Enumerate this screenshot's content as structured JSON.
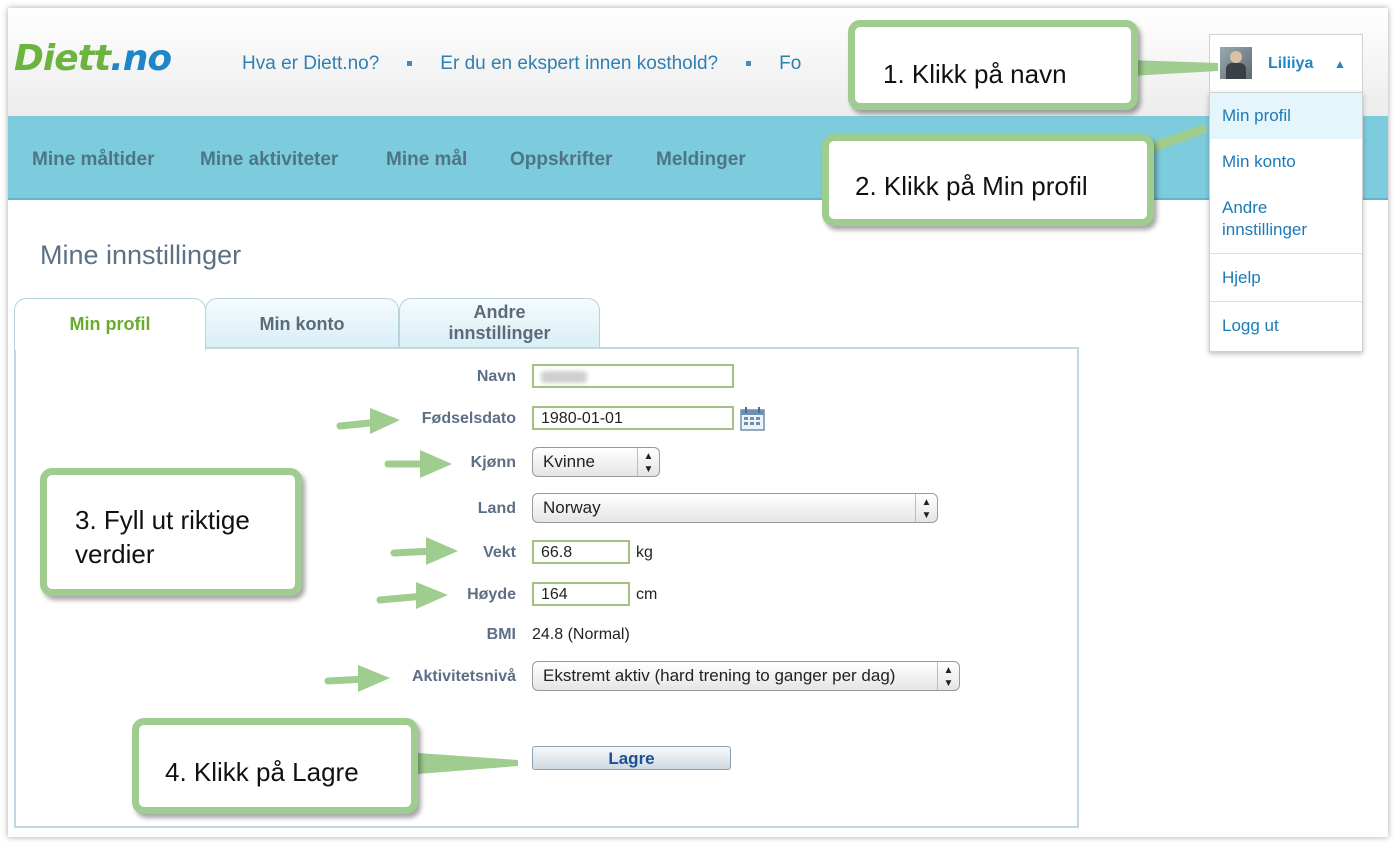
{
  "logo": {
    "part1": "Diett",
    "part2": ".no"
  },
  "header": {
    "links": [
      "Hva er Diett.no?",
      "Er du en ekspert innen kosthold?",
      "Fo"
    ]
  },
  "nav": {
    "items": [
      "Mine måltider",
      "Mine aktiviteter",
      "Mine mål",
      "Oppskrifter",
      "Meldinger"
    ]
  },
  "user": {
    "name": "Liliiya",
    "menu": [
      "Min profil",
      "Min konto",
      "Andre innstillinger",
      "Hjelp",
      "Logg ut"
    ]
  },
  "page": {
    "title": "Mine innstillinger"
  },
  "tabs": {
    "active": "Min profil",
    "items": [
      "Min profil",
      "Min konto",
      "Andre innstillinger"
    ]
  },
  "form": {
    "name_label": "Navn",
    "birth_label": "Fødselsdato",
    "birth_value": "1980-01-01",
    "gender_label": "Kjønn",
    "gender_value": "Kvinne",
    "country_label": "Land",
    "country_value": "Norway",
    "weight_label": "Vekt",
    "weight_value": "66.8",
    "weight_unit": "kg",
    "height_label": "Høyde",
    "height_value": "164",
    "height_unit": "cm",
    "bmi_label": "BMI",
    "bmi_value": "24.8 (Normal)",
    "activity_label": "Aktivitetsnivå",
    "activity_value": "Ekstremt aktiv (hard trening to ganger per dag)",
    "save_label": "Lagre"
  },
  "callouts": {
    "step1": "1. Klikk på navn",
    "step2": "2. Klikk på Min profil",
    "step3_line1": "3. Fyll ut riktige",
    "step3_line2": "verdier",
    "step4": "4. Klikk på Lagre"
  },
  "colors": {
    "nav_bg": "#7dccde",
    "logo_green": "#6cb33f",
    "logo_blue": "#1e86c7",
    "callout_border": "#9fcc8f",
    "active_tab_text": "#6aab2c"
  }
}
